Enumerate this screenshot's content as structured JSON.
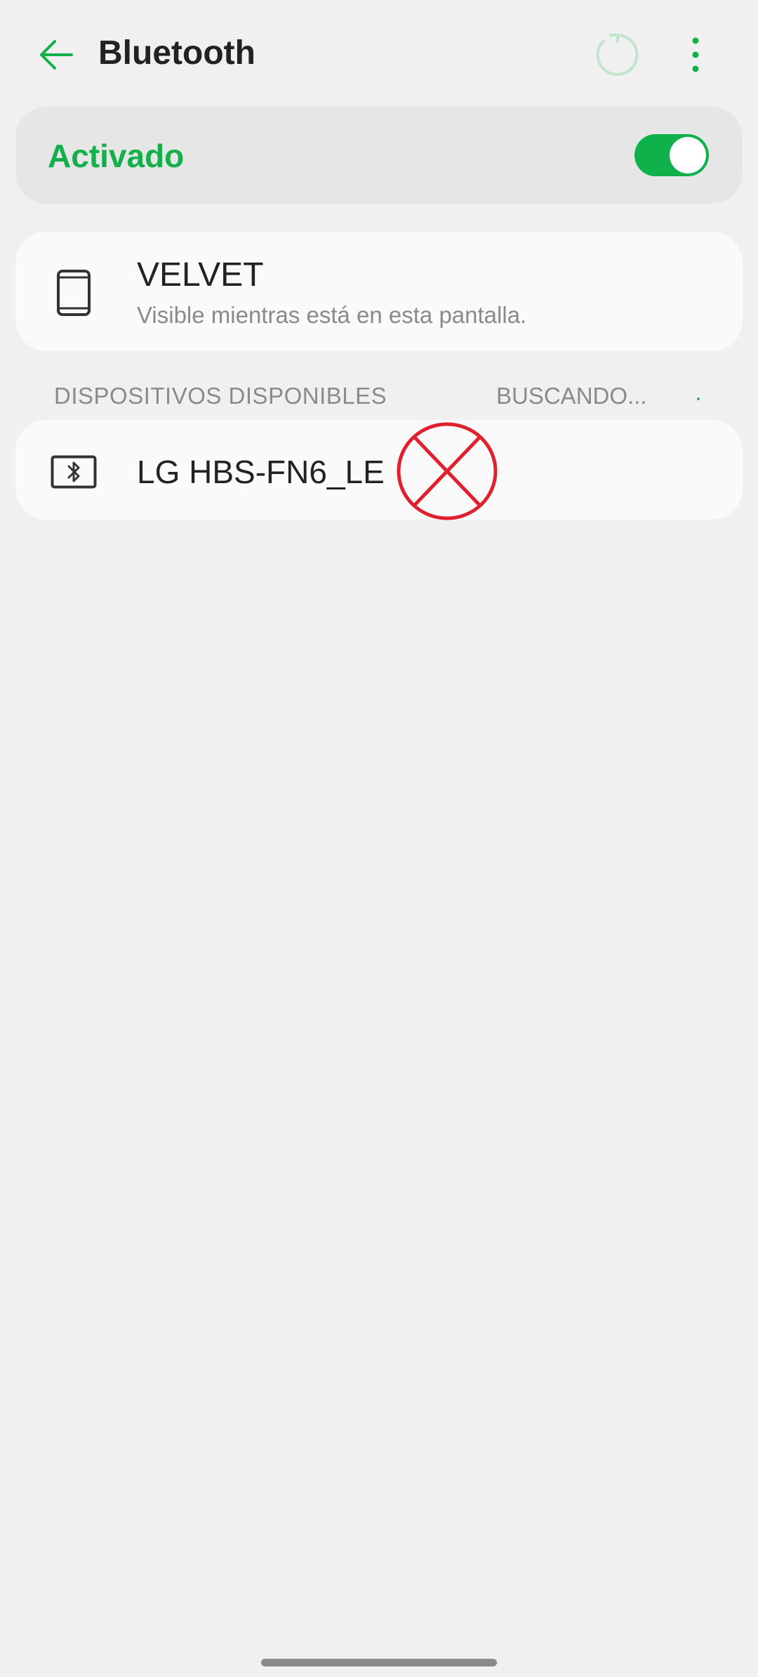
{
  "app_bar": {
    "title": "Bluetooth",
    "back_icon": "arrow-back-icon",
    "refresh_icon": "refresh-icon",
    "menu_icon": "more-vert-icon"
  },
  "bluetooth_toggle": {
    "label": "Activado",
    "state": "on"
  },
  "this_device": {
    "name": "VELVET",
    "subtitle": "Visible mientras está en esta pantalla.",
    "icon": "phone-icon"
  },
  "available_devices": {
    "header": "DISPOSITIVOS DISPONIBLES",
    "status": "BUSCANDO...",
    "items": [
      {
        "name": "LG HBS-FN6_LE",
        "icon": "bluetooth-device-icon"
      }
    ]
  },
  "overlay_mark": {
    "icon": "red-circle-x-mark"
  },
  "colors": {
    "accent": "#12b04a",
    "switch": "#0fb14a",
    "background": "#f0f0f0",
    "card": "#fafafa",
    "secondary_text": "#8a8a8a",
    "mark": "#e0202c"
  }
}
